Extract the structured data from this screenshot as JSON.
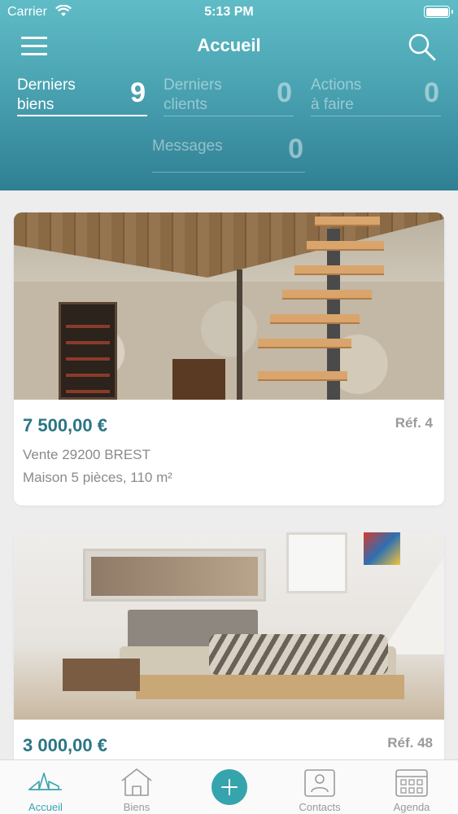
{
  "status_bar": {
    "carrier": "Carrier",
    "time": "5:13 PM"
  },
  "header": {
    "title": "Accueil"
  },
  "stats": [
    {
      "label": "Derniers\nbiens",
      "count": "9",
      "active": true
    },
    {
      "label": "Derniers\nclients",
      "count": "0",
      "active": false
    },
    {
      "label": "Actions\nà faire",
      "count": "0",
      "active": false
    },
    {
      "label": "Messages",
      "count": "0",
      "active": false
    }
  ],
  "properties": [
    {
      "price": "7 500,00 €",
      "ref": "Réf. 4",
      "transaction": "Vente 29200 BREST",
      "description": "Maison 5 pièces, 110 m²"
    },
    {
      "price": "3 000,00 €",
      "ref": "Réf. 48"
    }
  ],
  "tabbar": {
    "items": [
      {
        "label": "Accueil",
        "icon": "home-buildings-icon",
        "active": true
      },
      {
        "label": "Biens",
        "icon": "house-icon",
        "active": false
      },
      {
        "label": "",
        "icon": "plus-icon",
        "active": false
      },
      {
        "label": "Contacts",
        "icon": "contact-card-icon",
        "active": false
      },
      {
        "label": "Agenda",
        "icon": "calendar-icon",
        "active": false
      }
    ]
  },
  "colors": {
    "header_top": "#5fbcc6",
    "header_bottom": "#2f7f93",
    "price": "#2b7585",
    "accent": "#35a4ad"
  }
}
